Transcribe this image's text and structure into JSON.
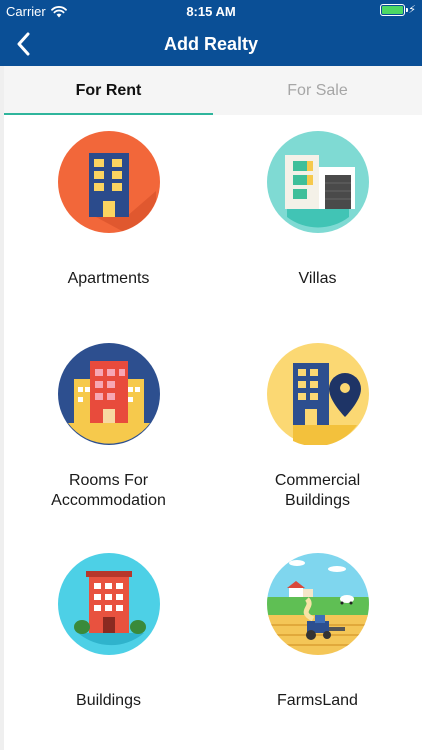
{
  "status": {
    "carrier": "Carrier",
    "time": "8:15 AM",
    "battery_level": 1.0
  },
  "nav": {
    "title": "Add Realty",
    "back_icon": "chevron-left-icon"
  },
  "tabs": [
    {
      "label": "For Rent",
      "active": true
    },
    {
      "label": "For Sale",
      "active": false
    }
  ],
  "categories": [
    {
      "label_lines": [
        "Apartments"
      ],
      "icon": "apartment-building-icon"
    },
    {
      "label_lines": [
        "Villas"
      ],
      "icon": "villa-icon"
    },
    {
      "label_lines": [
        "Rooms For",
        "Accommodation"
      ],
      "icon": "rooms-building-icon"
    },
    {
      "label_lines": [
        "Commercial",
        "Buildings"
      ],
      "icon": "commercial-building-pin-icon"
    },
    {
      "label_lines": [
        "Buildings"
      ],
      "icon": "red-building-icon"
    },
    {
      "label_lines": [
        "FarmsLand"
      ],
      "icon": "farm-tractor-icon"
    }
  ],
  "colors": {
    "header": "#0a4f96",
    "tab_indicator": "#2fb59c",
    "tab_bg": "#f5f5f5",
    "inactive_tab": "#a6a6a6"
  }
}
